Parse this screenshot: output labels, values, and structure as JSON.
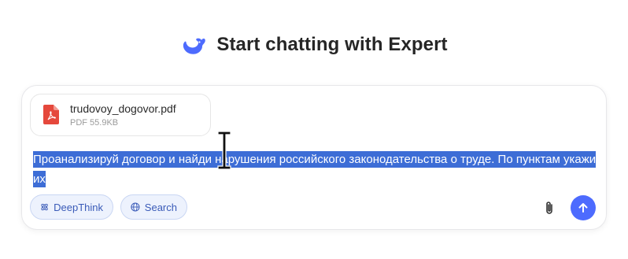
{
  "header": {
    "logo_icon": "whale-logo-icon",
    "title": "Start chatting with Expert"
  },
  "attachment": {
    "icon": "pdf-file-icon",
    "file_name": "trudovoy_dogovor.pdf",
    "file_meta": "PDF 55.9KB"
  },
  "input": {
    "text": "Проанализируй договор и найди нарушения российского законодательства о труде. По пунктам укажи их"
  },
  "buttons": {
    "deepthink_label": "DeepThink",
    "search_label": "Search",
    "attach_icon": "paperclip-icon",
    "send_icon": "arrow-up-icon"
  },
  "colors": {
    "accent": "#4d6bfe",
    "selection": "#3d6dd6",
    "pill_bg": "#edf2fd",
    "pill_text": "#3a5bb8",
    "pdf_red": "#e5483c"
  }
}
